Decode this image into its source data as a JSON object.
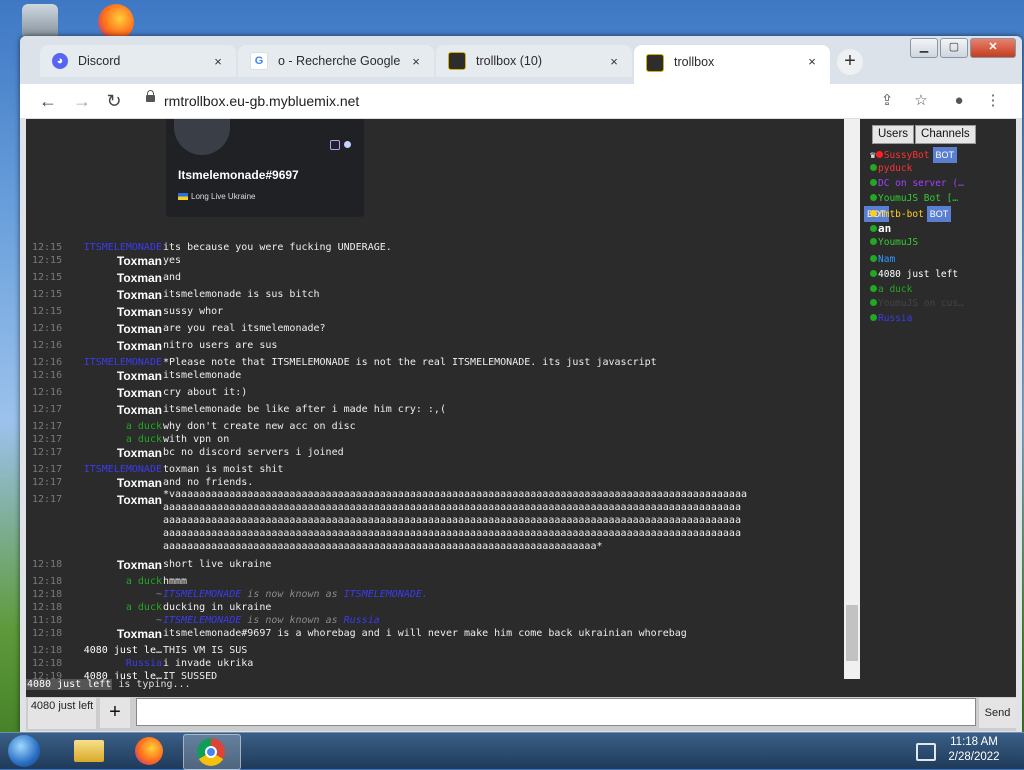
{
  "browser": {
    "tabs": [
      {
        "title": "Discord",
        "favicon": "discord-icon",
        "close": "×",
        "active": false
      },
      {
        "title": "o - Recherche Google",
        "favicon": "google-icon",
        "close": "×",
        "active": false
      },
      {
        "title": "trollbox (10)",
        "favicon": "trollbox-icon",
        "close": "×",
        "active": false
      },
      {
        "title": "trollbox",
        "favicon": "trollbox-icon",
        "close": "×",
        "active": true
      }
    ],
    "new_tab": "+",
    "url": "rmtrollbox.eu-gb.mybluemix.net",
    "win_min": "▁",
    "win_max": "▢",
    "win_close": "✕"
  },
  "image_card": {
    "name": "Itsmelemonade#9697",
    "subtitle": "Long Live Ukraine"
  },
  "colors": {
    "itsmelemonade": "#3b3bf0",
    "duck": "#22a822",
    "renamed": "#3b3bf0",
    "typing_user_bg": "#555555"
  },
  "messages": [
    {
      "time": "12:15",
      "user": "ITSMELEMONADE",
      "style": "lemon",
      "text": "its because you were fucking UNDERAGE."
    },
    {
      "time": "12:15",
      "user": "Toxman",
      "style": "big",
      "text": "yes"
    },
    {
      "time": "12:15",
      "user": "Toxman",
      "style": "big",
      "text": "and"
    },
    {
      "time": "12:15",
      "user": "Toxman",
      "style": "big",
      "text": "itsmelemonade is sus bitch"
    },
    {
      "time": "12:15",
      "user": "Toxman",
      "style": "big",
      "text": "sussy whor"
    },
    {
      "time": "12:16",
      "user": "Toxman",
      "style": "big",
      "text": "are you real itsmelemonade?"
    },
    {
      "time": "12:16",
      "user": "Toxman",
      "style": "big",
      "text": "nitro users are sus"
    },
    {
      "time": "12:16",
      "user": "ITSMELEMONADE",
      "style": "lemon",
      "text": "*Please note that ITSMELEMONADE is not the real ITSMELEMONADE. its just javascript"
    },
    {
      "time": "12:16",
      "user": "Toxman",
      "style": "big",
      "text": "itsmelemonade"
    },
    {
      "time": "12:16",
      "user": "Toxman",
      "style": "big",
      "text": "cry about it:)"
    },
    {
      "time": "12:17",
      "user": "Toxman",
      "style": "big",
      "text": "itsmelemonade be like after i made him cry:   :,("
    },
    {
      "time": "12:17",
      "user": "a duck",
      "style": "duck",
      "text": "why don't create new acc on disc"
    },
    {
      "time": "12:17",
      "user": "a duck",
      "style": "duck",
      "text": "with vpn on"
    },
    {
      "time": "12:17",
      "user": "Toxman",
      "style": "big",
      "text": "bc no discord servers i joined"
    },
    {
      "time": "12:17",
      "user": "ITSMELEMONADE",
      "style": "lemon",
      "text": "toxman is moist shit"
    },
    {
      "time": "12:17",
      "user": "Toxman",
      "style": "big",
      "text": "and no friends."
    },
    {
      "time": "12:17",
      "user": "Toxman",
      "style": "big",
      "text": ""
    },
    {
      "time": "12:18",
      "user": "Toxman",
      "style": "big",
      "text": "short live ukraine"
    },
    {
      "time": "12:18",
      "user": "a duck",
      "style": "duck",
      "text": "hmmm"
    },
    {
      "time": "12:18",
      "user": "~",
      "style": "sys",
      "text": "",
      "rename_from": "ITSMELEMONADE",
      "rename_mid": " is now known as ",
      "rename_to": "ITSMELEMONADE."
    },
    {
      "time": "12:18",
      "user": "a duck",
      "style": "duck",
      "text": "ducking in ukraine"
    },
    {
      "time": "11:18",
      "user": "~",
      "style": "sys",
      "text": "",
      "rename_from": "ITSMELEMONADE   ",
      "rename_mid": " is now known as ",
      "rename_to": "Russia"
    },
    {
      "time": "12:18",
      "user": "Toxman",
      "style": "big",
      "text": "itsmelemonade#9697 is a whorebag and i will never make him come back ukrainian whorebag"
    },
    {
      "time": "12:18",
      "user": "4080 just le…",
      "style": "white",
      "text": "THIS VM IS SUS"
    },
    {
      "time": "12:18",
      "user": "Russia",
      "style": "lemon",
      "text": "i invade ukrika"
    },
    {
      "time": "12:19",
      "user": "4080 just le…",
      "style": "white",
      "text": "IT SUSSED"
    }
  ],
  "long_message": "*vaaaaaaaaaaaaaaaaaaaaaaaaaaaaaaaaaaaaaaaaaaaaaaaaaaaaaaaaaaaaaaaaaaaaaaaaaaaaaaaaaaaaaaaaaaaaaaa\naaaaaaaaaaaaaaaaaaaaaaaaaaaaaaaaaaaaaaaaaaaaaaaaaaaaaaaaaaaaaaaaaaaaaaaaaaaaaaaaaaaaaaaaaaaaaaaa\naaaaaaaaaaaaaaaaaaaaaaaaaaaaaaaaaaaaaaaaaaaaaaaaaaaaaaaaaaaaaaaaaaaaaaaaaaaaaaaaaaaaaaaaaaaaaaaa\naaaaaaaaaaaaaaaaaaaaaaaaaaaaaaaaaaaaaaaaaaaaaaaaaaaaaaaaaaaaaaaaaaaaaaaaaaaaaaaaaaaaaaaaaaaaaaaa\naaaaaaaaaaaaaaaaaaaaaaaaaaaaaaaaaaaaaaaaaaaaaaaaaaaaaaaaaaaaaaaaaaaaaaaa*",
  "sidebar": {
    "tab_users": "Users",
    "tab_channels": "Channels",
    "users": [
      {
        "prefix": "♛",
        "dot": "#ff2020",
        "name": "SussyBot",
        "color": "#ff3030",
        "bot": "BOT"
      },
      {
        "prefix": "",
        "dot": "#22a822",
        "name": "pyduck",
        "color": "#ff3030",
        "bot": ""
      },
      {
        "prefix": "",
        "dot": "#22a822",
        "name": "DC on server (…",
        "color": "#a040ff",
        "bot": ""
      },
      {
        "prefix": "",
        "dot": "#22a822",
        "name": "YoumuJS Bot […",
        "color": "#33cc33",
        "bot": "BOT"
      },
      {
        "prefix": "",
        "dot": "#ffd020",
        "name": "rmtb-bot",
        "color": "#ffd020",
        "bot": "BOT"
      },
      {
        "prefix": "",
        "dot": "#22a822",
        "name": "an",
        "color": "#ffffff",
        "bot": ""
      },
      {
        "prefix": "",
        "dot": "#22a822",
        "name": "YoumuJS",
        "color": "#33cc33",
        "bot": ""
      },
      {
        "prefix": "",
        "dot": "#22a822",
        "name": "Nam",
        "color": "#3399ff",
        "bot": ""
      },
      {
        "prefix": "",
        "dot": "#22a822",
        "name": "4080 just left",
        "color": "#ffffff",
        "bot": ""
      },
      {
        "prefix": "",
        "dot": "#22a822",
        "name": "a duck",
        "color": "#22a822",
        "bot": ""
      },
      {
        "prefix": "",
        "dot": "#22a822",
        "name": "YoumuJS on cus…",
        "color": "#444444",
        "bot": ""
      },
      {
        "prefix": "",
        "dot": "#22a822",
        "name": "Russia",
        "color": "#3b3bf0",
        "bot": ""
      }
    ]
  },
  "typing": {
    "user": "4080 just left",
    "text": " is typing..."
  },
  "composer": {
    "nick": "4080 just left",
    "plus": "+",
    "send": "Send",
    "input_value": ""
  },
  "taskbar": {
    "apps": [
      "explorer-icon",
      "firefox-icon",
      "chrome-icon"
    ],
    "time": "11:18 AM",
    "date": "2/28/2022"
  }
}
